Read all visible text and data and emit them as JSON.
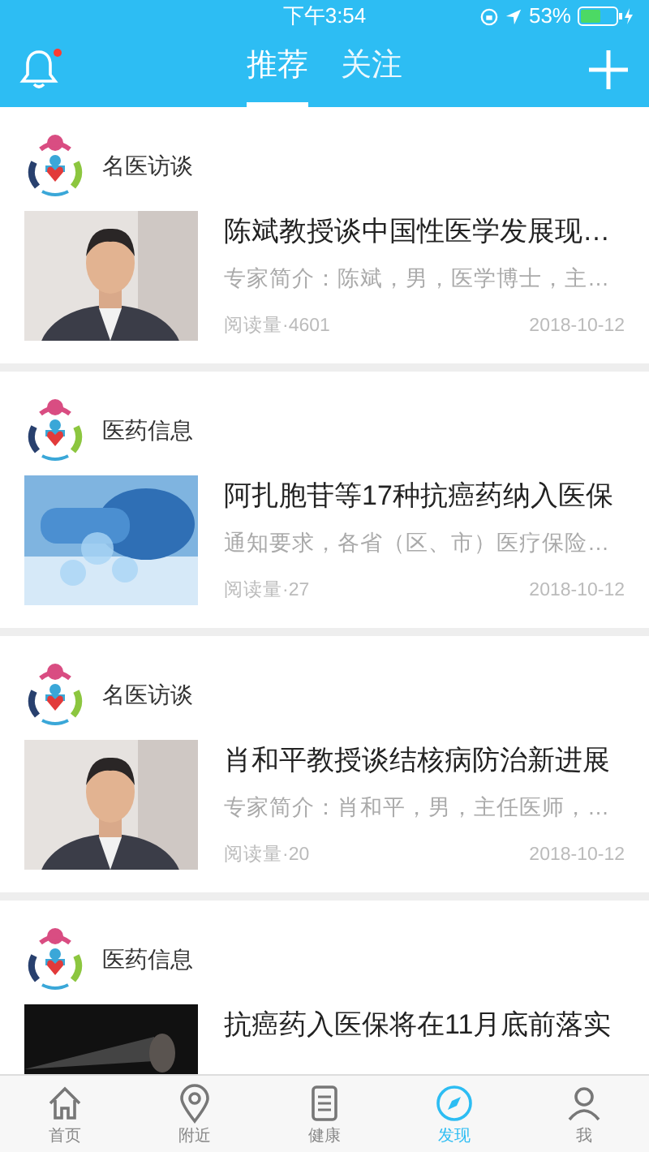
{
  "status_bar": {
    "time": "下午3:54",
    "battery": "53%"
  },
  "header": {
    "notification_dot": true,
    "tabs": [
      {
        "label": "推荐",
        "selected": true
      },
      {
        "label": "关注",
        "selected": false
      }
    ]
  },
  "feed": [
    {
      "category": "名医访谈",
      "title": "陈斌教授谈中国性医学发展现…",
      "summary": "专家简介：陈斌，男，医学博士，主…",
      "reads": "阅读量·4601",
      "date": "2018-10-12"
    },
    {
      "category": "医药信息",
      "title": "阿扎胞苷等17种抗癌药纳入医保",
      "summary": "通知要求，各省（区、市）医疗保险…",
      "reads": "阅读量·27",
      "date": "2018-10-12"
    },
    {
      "category": "名医访谈",
      "title": "肖和平教授谈结核病防治新进展",
      "summary": "专家简介：肖和平，男，主任医师，…",
      "reads": "阅读量·20",
      "date": "2018-10-12"
    },
    {
      "category": "医药信息",
      "title": "抗癌药入医保将在11月底前落实"
    }
  ],
  "tab_bar": [
    {
      "label": "首页",
      "selected": false
    },
    {
      "label": "附近",
      "selected": false
    },
    {
      "label": "健康",
      "selected": false
    },
    {
      "label": "发现",
      "selected": true
    },
    {
      "label": "我",
      "selected": false
    }
  ]
}
